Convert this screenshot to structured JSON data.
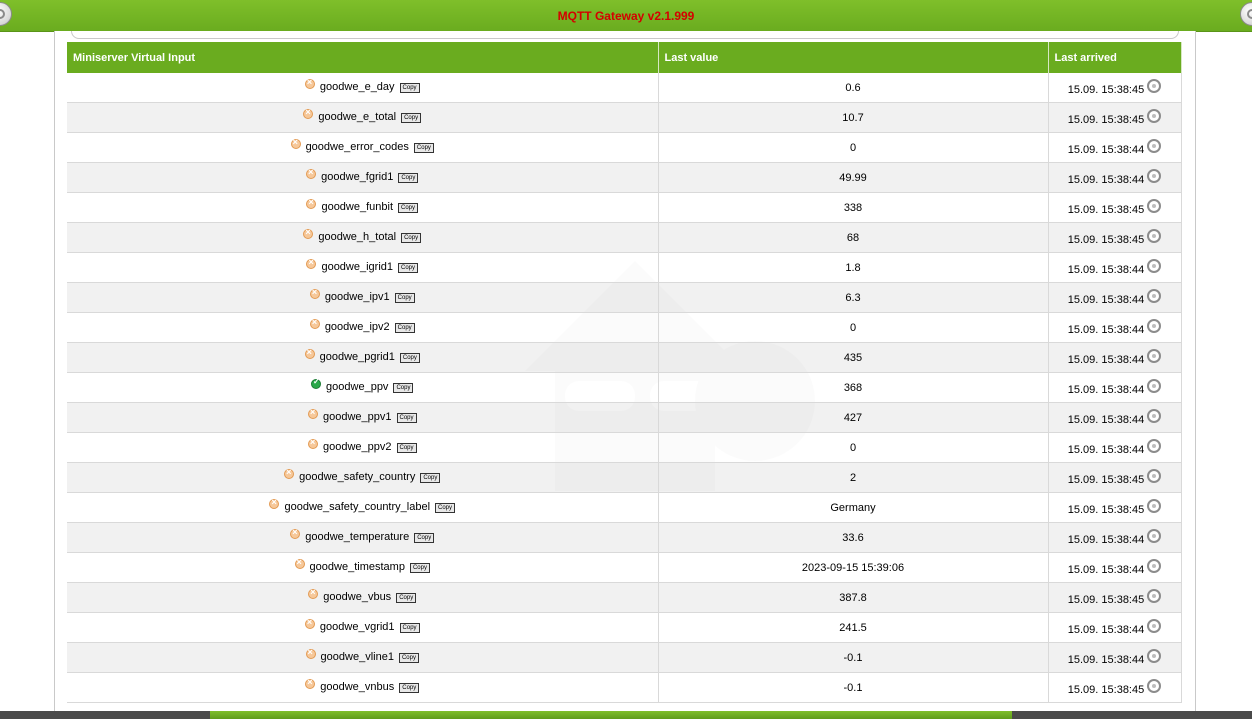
{
  "header": {
    "title": "MQTT Gateway v2.1.999"
  },
  "table": {
    "columns": [
      "Miniserver Virtual Input",
      "Last value",
      "Last arrived"
    ],
    "copy_label": "Copy",
    "rows": [
      {
        "name": "goodwe_e_day",
        "value": "0.6",
        "arrived": "15.09. 15:38:45",
        "status": "warn"
      },
      {
        "name": "goodwe_e_total",
        "value": "10.7",
        "arrived": "15.09. 15:38:45",
        "status": "warn"
      },
      {
        "name": "goodwe_error_codes",
        "value": "0",
        "arrived": "15.09. 15:38:44",
        "status": "warn"
      },
      {
        "name": "goodwe_fgrid1",
        "value": "49.99",
        "arrived": "15.09. 15:38:44",
        "status": "warn"
      },
      {
        "name": "goodwe_funbit",
        "value": "338",
        "arrived": "15.09. 15:38:45",
        "status": "warn"
      },
      {
        "name": "goodwe_h_total",
        "value": "68",
        "arrived": "15.09. 15:38:45",
        "status": "warn"
      },
      {
        "name": "goodwe_igrid1",
        "value": "1.8",
        "arrived": "15.09. 15:38:44",
        "status": "warn"
      },
      {
        "name": "goodwe_ipv1",
        "value": "6.3",
        "arrived": "15.09. 15:38:44",
        "status": "warn"
      },
      {
        "name": "goodwe_ipv2",
        "value": "0",
        "arrived": "15.09. 15:38:44",
        "status": "warn"
      },
      {
        "name": "goodwe_pgrid1",
        "value": "435",
        "arrived": "15.09. 15:38:44",
        "status": "warn"
      },
      {
        "name": "goodwe_ppv",
        "value": "368",
        "arrived": "15.09. 15:38:44",
        "status": "ok"
      },
      {
        "name": "goodwe_ppv1",
        "value": "427",
        "arrived": "15.09. 15:38:44",
        "status": "warn"
      },
      {
        "name": "goodwe_ppv2",
        "value": "0",
        "arrived": "15.09. 15:38:44",
        "status": "warn"
      },
      {
        "name": "goodwe_safety_country",
        "value": "2",
        "arrived": "15.09. 15:38:45",
        "status": "warn"
      },
      {
        "name": "goodwe_safety_country_label",
        "value": "Germany",
        "arrived": "15.09. 15:38:45",
        "status": "warn"
      },
      {
        "name": "goodwe_temperature",
        "value": "33.6",
        "arrived": "15.09. 15:38:44",
        "status": "warn"
      },
      {
        "name": "goodwe_timestamp",
        "value": "2023-09-15 15:39:06",
        "arrived": "15.09. 15:38:44",
        "status": "warn"
      },
      {
        "name": "goodwe_vbus",
        "value": "387.8",
        "arrived": "15.09. 15:38:45",
        "status": "warn"
      },
      {
        "name": "goodwe_vgrid1",
        "value": "241.5",
        "arrived": "15.09. 15:38:44",
        "status": "warn"
      },
      {
        "name": "goodwe_vline1",
        "value": "-0.1",
        "arrived": "15.09. 15:38:44",
        "status": "warn"
      },
      {
        "name": "goodwe_vnbus",
        "value": "-0.1",
        "arrived": "15.09. 15:38:45",
        "status": "warn"
      }
    ]
  },
  "icons": {
    "warn_status": "warning-status-icon",
    "ok_status": "ok-status-icon",
    "clock": "clock-icon",
    "corner_button": "round-button-icon"
  },
  "colors": {
    "header_green": "#6aac1f",
    "title_red": "#d40000",
    "ok_green": "#2aa84a",
    "warn_orange": "#e39a52"
  }
}
